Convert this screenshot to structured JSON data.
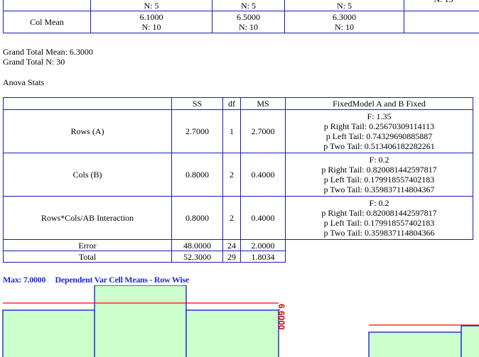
{
  "top_table": {
    "n_row": [
      "N: 5",
      "N: 5",
      "N: 5",
      "N: 15"
    ],
    "col_mean_label": "Col Mean",
    "col_means": [
      {
        "mean": "6.1000",
        "n": "N: 10"
      },
      {
        "mean": "6.5000",
        "n": "N: 10"
      },
      {
        "mean": "6.3000",
        "n": "N: 10"
      }
    ]
  },
  "grand_total_mean": "Grand Total Mean: 6.3000",
  "grand_total_n": "Grand Total N: 30",
  "anova_heading": "Anova Stats",
  "anova": {
    "headers": {
      "ss": "SS",
      "df": "df",
      "ms": "MS",
      "model": "FixedModel A and B Fixed"
    },
    "rows": [
      {
        "label": "Rows (A)",
        "ss": "2.7000",
        "df": "1",
        "ms": "2.7000",
        "f": "F: 1.35",
        "right": "p Right Tail: 0.25670309114113",
        "left": "p Left Tail: 0.74329690885887",
        "two": "p Two Tail: 0.513406182282261"
      },
      {
        "label": "Cols (B)",
        "ss": "0.8000",
        "df": "2",
        "ms": "0.4000",
        "f": "F: 0.2",
        "right": "p Right Tail: 0.820081442597817",
        "left": "p Left Tail: 0.179918557402183",
        "two": "p Two Tail: 0.359837114804367"
      },
      {
        "label": "Rows*Cols/AB Interaction",
        "ss": "0.8000",
        "df": "2",
        "ms": "0.4000",
        "f": "F: 0.2",
        "right": "p Right Tail: 0.820081442597817",
        "left": "p Left Tail: 0.179918557402183",
        "two": "p Two Tail: 0.359837114804366"
      }
    ],
    "error": {
      "label": "Error",
      "ss": "48.0000",
      "df": "24",
      "ms": "2.0000"
    },
    "total": {
      "label": "Total",
      "ss": "52.3000",
      "df": "29",
      "ms": "1.8034"
    }
  },
  "chart_header": {
    "max_label": "Max: 7.0000",
    "title": "Dependent Var Cell Means - Row Wise"
  },
  "chart_data": {
    "type": "bar",
    "title": "Dependent Var Cell Means - Row Wise",
    "max": 7.0,
    "reference_line_value": 6.3,
    "ref_label": "6.6000",
    "colors": {
      "bar_fill": "#ccffcc",
      "bar_stroke": "#0000cc",
      "ref_line": "#ff0000",
      "ref_label": "#cc0000"
    }
  }
}
